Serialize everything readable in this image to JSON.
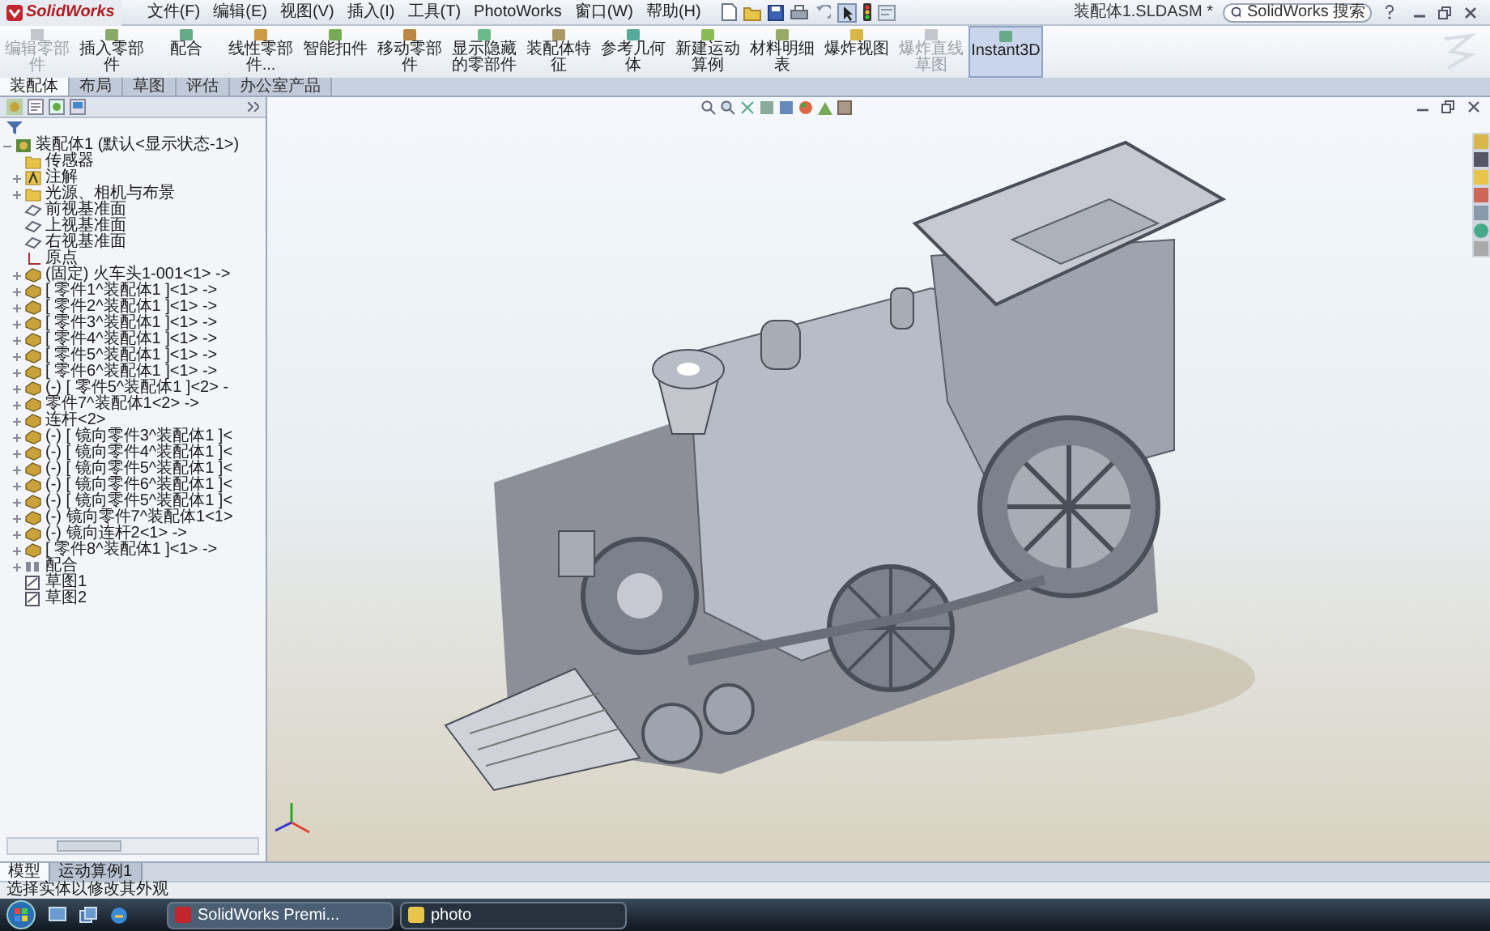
{
  "app": {
    "logo": "SolidWorks"
  },
  "menu": [
    "文件(F)",
    "编辑(E)",
    "视图(V)",
    "插入(I)",
    "工具(T)",
    "PhotoWorks",
    "窗口(W)",
    "帮助(H)"
  ],
  "window": {
    "title": "装配体1.SLDASM *"
  },
  "search": {
    "placeholder": "SolidWorks 搜索"
  },
  "commands": [
    {
      "label": "编辑零部件",
      "disabled": true,
      "selected": false
    },
    {
      "label": "插入零部件",
      "disabled": false,
      "selected": false
    },
    {
      "label": "配合",
      "disabled": false,
      "selected": false
    },
    {
      "label": "线性零部件...",
      "disabled": false,
      "selected": false
    },
    {
      "label": "智能扣件",
      "disabled": false,
      "selected": false
    },
    {
      "label": "移动零部件",
      "disabled": false,
      "selected": false
    },
    {
      "label": "显示隐藏的零部件",
      "disabled": false,
      "selected": false
    },
    {
      "label": "装配体特征",
      "disabled": false,
      "selected": false
    },
    {
      "label": "参考几何体",
      "disabled": false,
      "selected": false
    },
    {
      "label": "新建运动算例",
      "disabled": false,
      "selected": false
    },
    {
      "label": "材料明细表",
      "disabled": false,
      "selected": false
    },
    {
      "label": "爆炸视图",
      "disabled": false,
      "selected": false
    },
    {
      "label": "爆炸直线草图",
      "disabled": true,
      "selected": false
    },
    {
      "label": "Instant3D",
      "disabled": false,
      "selected": true
    }
  ],
  "tabs": [
    {
      "label": "装配体",
      "selected": true
    },
    {
      "label": "布局",
      "selected": false
    },
    {
      "label": "草图",
      "selected": false
    },
    {
      "label": "评估",
      "selected": false
    },
    {
      "label": "办公室产品",
      "selected": false
    }
  ],
  "tree": {
    "label": "装配体1 (默认<显示状态-1>)",
    "kind": "assembly",
    "expanded": true,
    "children": [
      {
        "label": "传感器",
        "kind": "folder",
        "expandable": false
      },
      {
        "label": "注解",
        "kind": "annotation",
        "expandable": true
      },
      {
        "label": "光源、相机与布景",
        "kind": "folder",
        "expandable": true
      },
      {
        "label": "前视基准面",
        "kind": "plane",
        "expandable": false
      },
      {
        "label": "上视基准面",
        "kind": "plane",
        "expandable": false
      },
      {
        "label": "右视基准面",
        "kind": "plane",
        "expandable": false
      },
      {
        "label": "原点",
        "kind": "origin",
        "expandable": false
      },
      {
        "label": "(固定) 火车头1-001<1> ->",
        "kind": "part",
        "expandable": true
      },
      {
        "label": "[ 零件1^装配体1 ]<1> ->",
        "kind": "part",
        "expandable": true
      },
      {
        "label": "[ 零件2^装配体1 ]<1> ->",
        "kind": "part",
        "expandable": true
      },
      {
        "label": "[ 零件3^装配体1 ]<1> ->",
        "kind": "part",
        "expandable": true
      },
      {
        "label": "[ 零件4^装配体1 ]<1> ->",
        "kind": "part",
        "expandable": true
      },
      {
        "label": "[ 零件5^装配体1 ]<1> ->",
        "kind": "part",
        "expandable": true
      },
      {
        "label": "[ 零件6^装配体1 ]<1> ->",
        "kind": "part",
        "expandable": true
      },
      {
        "label": "(-) [ 零件5^装配体1 ]<2> -",
        "kind": "part",
        "expandable": true
      },
      {
        "label": "零件7^装配体1<2> ->",
        "kind": "part",
        "expandable": true
      },
      {
        "label": "连杆<2>",
        "kind": "part",
        "expandable": true
      },
      {
        "label": "(-) [ 镜向零件3^装配体1 ]<",
        "kind": "part",
        "expandable": true
      },
      {
        "label": "(-) [ 镜向零件4^装配体1 ]<",
        "kind": "part",
        "expandable": true
      },
      {
        "label": "(-) [ 镜向零件5^装配体1 ]<",
        "kind": "part",
        "expandable": true
      },
      {
        "label": "(-) [ 镜向零件6^装配体1 ]<",
        "kind": "part",
        "expandable": true
      },
      {
        "label": "(-) [ 镜向零件5^装配体1 ]<",
        "kind": "part",
        "expandable": true
      },
      {
        "label": "(-) 镜向零件7^装配体1<1>",
        "kind": "part",
        "expandable": true
      },
      {
        "label": "(-) 镜向连杆2<1> ->",
        "kind": "part",
        "expandable": true
      },
      {
        "label": "[ 零件8^装配体1 ]<1> ->",
        "kind": "part",
        "expandable": true
      },
      {
        "label": "配合",
        "kind": "mate",
        "expandable": true
      },
      {
        "label": "草图1",
        "kind": "sketch",
        "expandable": false
      },
      {
        "label": "草图2",
        "kind": "sketch",
        "expandable": false
      }
    ]
  },
  "model_tabs": [
    {
      "label": "模型",
      "selected": true
    },
    {
      "label": "运动算例1",
      "selected": false
    }
  ],
  "status_bar": "选择实体以修改其外观",
  "taskbar": [
    {
      "label": "SolidWorks Premi...",
      "selected": true
    },
    {
      "label": "photo",
      "selected": false
    }
  ]
}
